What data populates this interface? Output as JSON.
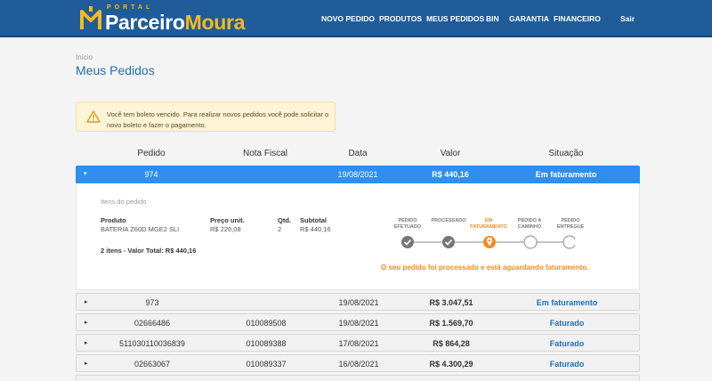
{
  "header": {
    "logo_small": "PORTAL",
    "logo_part1": "Parceiro",
    "logo_part2": "Moura",
    "nav": [
      "NOVO PEDIDO",
      "PRODUTOS",
      "MEUS PEDIDOS",
      "BIN",
      "GARANTIA",
      "FINANCEIRO"
    ],
    "logout": "Sair"
  },
  "breadcrumb": "Início",
  "page_title": "Meus Pedidos",
  "alert": {
    "icon": "warning-triangle-icon",
    "text": "Você tem boleto vencido. Para realizar novos pedidos você pode solicitar o novo boleto e fazer o pagamento."
  },
  "table": {
    "headers": [
      "Pedido",
      "Nota Fiscal",
      "Data",
      "Valor",
      "Situação"
    ],
    "expanded_row": {
      "pedido": "974",
      "nota_fiscal": "",
      "data": "19/08/2021",
      "valor": "R$ 440,16",
      "situacao": "Em faturamento"
    },
    "detail": {
      "title": "Itens do pedido",
      "headers": {
        "produto": "Produto",
        "preco": "Preço unit.",
        "qtd": "Qtd.",
        "subtotal": "Subtotal"
      },
      "item": {
        "produto": "BATERIA Z60D MGE2 SLI",
        "preco": "R$ 220,08",
        "qtd": "2",
        "subtotal": "R$ 440,16"
      },
      "total": "2 itens - Valor Total: R$ 440,16",
      "steps": [
        {
          "label": "PEDIDO EFETUADO",
          "state": "done"
        },
        {
          "label": "PROCESSADO",
          "state": "done"
        },
        {
          "label": "EM FATURAMENTO",
          "state": "current"
        },
        {
          "label": "PEDIDO A CAMINHO",
          "state": "pending"
        },
        {
          "label": "PEDIDO ENTREGUE",
          "state": "pending"
        }
      ],
      "message": "O seu pedido foi processado e está aguardando faturamento."
    },
    "rows": [
      {
        "pedido": "973",
        "nota_fiscal": "",
        "data": "19/08/2021",
        "valor": "R$ 3.047,51",
        "situacao": "Em faturamento"
      },
      {
        "pedido": "02666486",
        "nota_fiscal": "010089508",
        "data": "19/08/2021",
        "valor": "R$ 1.569,70",
        "situacao": "Faturado"
      },
      {
        "pedido": "511030110036839",
        "nota_fiscal": "010089388",
        "data": "17/08/2021",
        "valor": "R$ 864,28",
        "situacao": "Faturado"
      },
      {
        "pedido": "02663067",
        "nota_fiscal": "010089337",
        "data": "16/08/2021",
        "valor": "R$ 4.300,29",
        "situacao": "Faturado"
      }
    ]
  },
  "colors": {
    "header_bg": "#1f5c99",
    "accent": "#2e8ff0",
    "brand_yellow": "#f6b91e",
    "status_orange": "#f08c1e"
  }
}
